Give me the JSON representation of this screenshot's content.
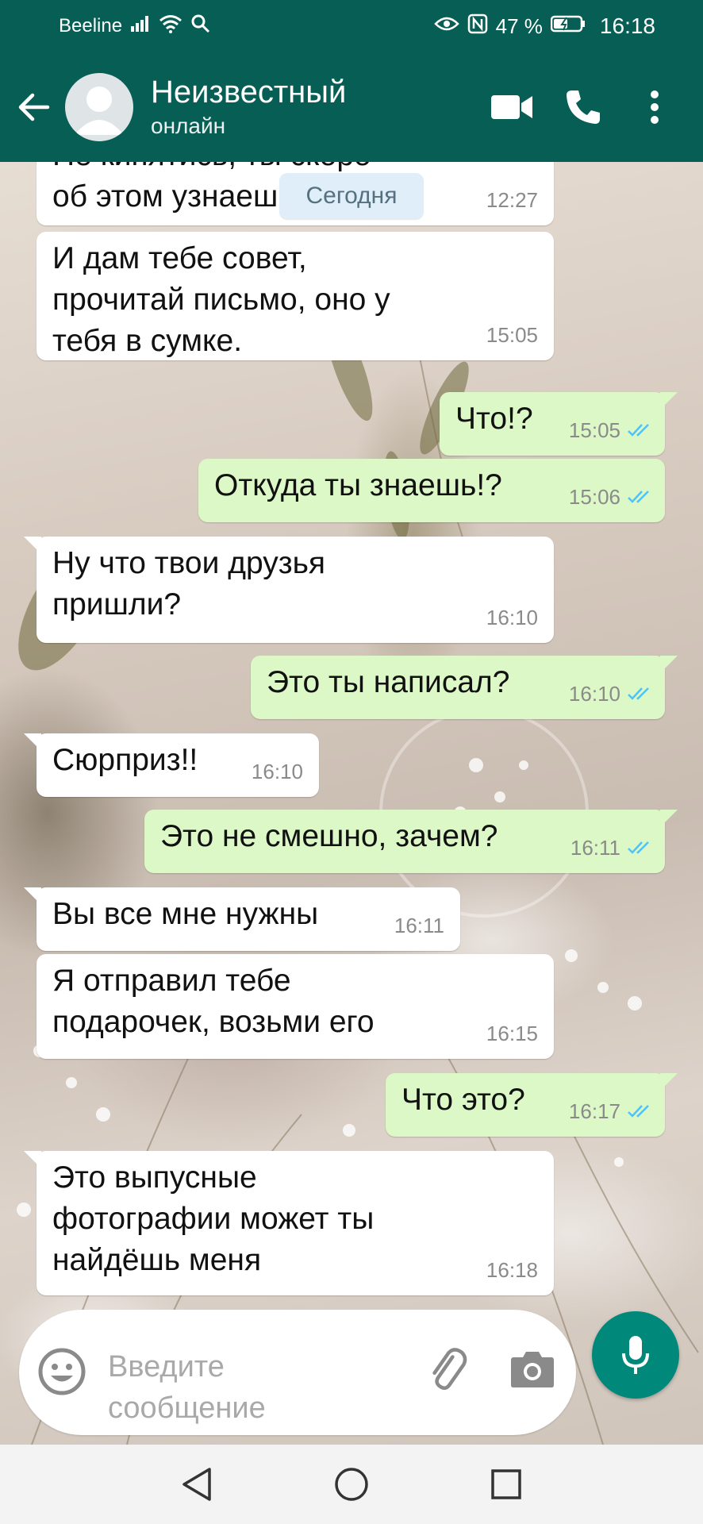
{
  "status_bar": {
    "carrier": "Beeline",
    "battery_percent": "47 %",
    "time": "16:18"
  },
  "header": {
    "contact_name": "Неизвестный",
    "contact_status": "онлайн"
  },
  "date_chip": "Сегодня",
  "messages": [
    {
      "direction": "in",
      "text": "Не кипятись, ты скоро\nоб этом узнаешь",
      "time": "12:27"
    },
    {
      "direction": "in",
      "text": "И дам тебе совет,\nпрочитай письмо, оно у\nтебя в сумке.",
      "time": "15:05"
    },
    {
      "direction": "out",
      "text": "Что!?",
      "time": "15:05",
      "status": "read"
    },
    {
      "direction": "out",
      "text": "Откуда ты знаешь!?",
      "time": "15:06",
      "status": "read"
    },
    {
      "direction": "in",
      "text": "Ну что твои друзья\nпришли?",
      "time": "16:10"
    },
    {
      "direction": "out",
      "text": "Это ты написал?",
      "time": "16:10",
      "status": "read"
    },
    {
      "direction": "in",
      "text": "Сюрприз!!",
      "time": "16:10"
    },
    {
      "direction": "out",
      "text": "Это не смешно, зачем?",
      "time": "16:11",
      "status": "read"
    },
    {
      "direction": "in",
      "text": "Вы все мне нужны",
      "time": "16:11"
    },
    {
      "direction": "in",
      "text": "Я отправил тебе\nподарочек, возьми его",
      "time": "16:15"
    },
    {
      "direction": "out",
      "text": "Что это?",
      "time": "16:17",
      "status": "read"
    },
    {
      "direction": "in",
      "text": "Это выпусные\nфотографии может ты\nнайдёшь меня",
      "time": "16:18"
    }
  ],
  "composer": {
    "placeholder": "Введите\nсообщение"
  },
  "colors": {
    "header_bg": "#075e54",
    "outgoing_bubble": "#dcf8c6",
    "incoming_bubble": "#ffffff",
    "mic_button": "#00897b",
    "read_ticks": "#4fc3f7"
  },
  "icons": [
    "back-arrow-icon",
    "avatar-placeholder-icon",
    "video-call-icon",
    "phone-icon",
    "more-vert-icon",
    "emoji-icon",
    "attach-icon",
    "camera-icon",
    "mic-icon",
    "nav-back-icon",
    "nav-home-icon",
    "nav-recents-icon",
    "double-check-icon"
  ]
}
